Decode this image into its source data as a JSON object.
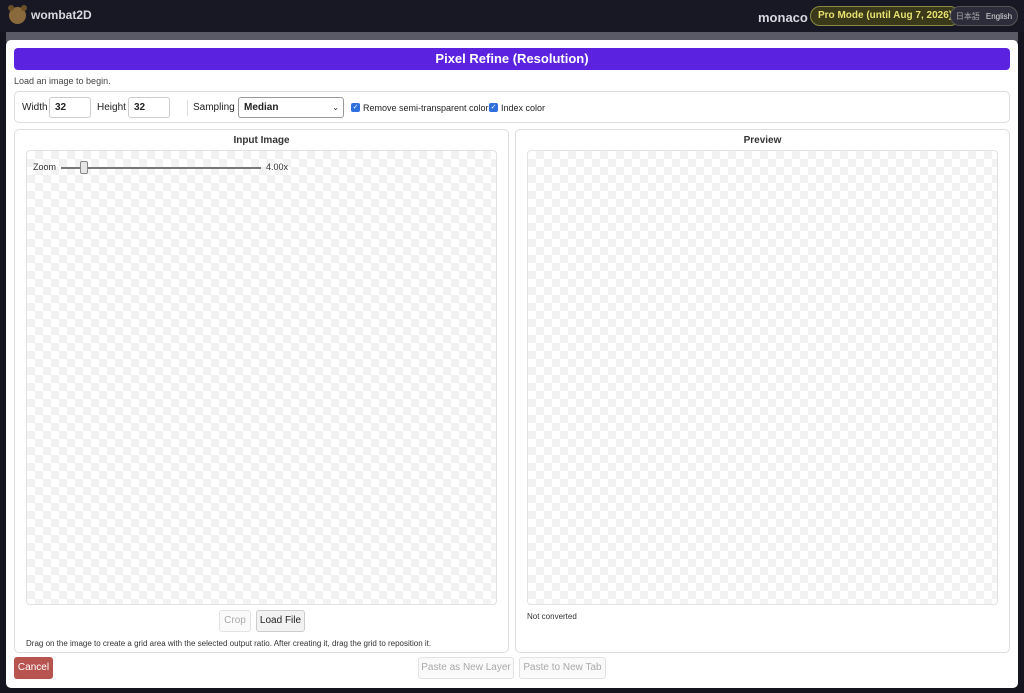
{
  "app": {
    "brand": "wombat2D",
    "user": "monaco",
    "pro_badge": "Pro Mode (until Aug 7, 2026)"
  },
  "lang": {
    "ja": "日本語",
    "en": "English"
  },
  "modal": {
    "title": "Pixel Refine (Resolution)",
    "status": "Load an image to begin.",
    "controls": {
      "width_label": "Width",
      "width_value": "32",
      "height_label": "Height",
      "height_value": "32",
      "sampling_label": "Sampling",
      "sampling_value": "Median",
      "remove_semi_label": "Remove semi-transparent colors",
      "remove_semi_checked": true,
      "index_color_label": "Index color",
      "index_color_checked": true
    },
    "input_panel": {
      "title": "Input Image",
      "zoom_label": "Zoom",
      "zoom_value": "4.00x",
      "crop_label": "Crop",
      "load_file_label": "Load File",
      "hint": "Drag on the image to create a grid area with the selected output ratio. After creating it, drag the grid to reposition it."
    },
    "preview_panel": {
      "title": "Preview",
      "status": "Not converted"
    },
    "footer": {
      "cancel_label": "Cancel",
      "paste_layer_label": "Paste as New Layer",
      "paste_tab_label": "Paste to New Tab"
    }
  },
  "colors": {
    "accent": "#5b22e0",
    "cancel": "#b85450",
    "checkbox": "#2f6fe0"
  }
}
